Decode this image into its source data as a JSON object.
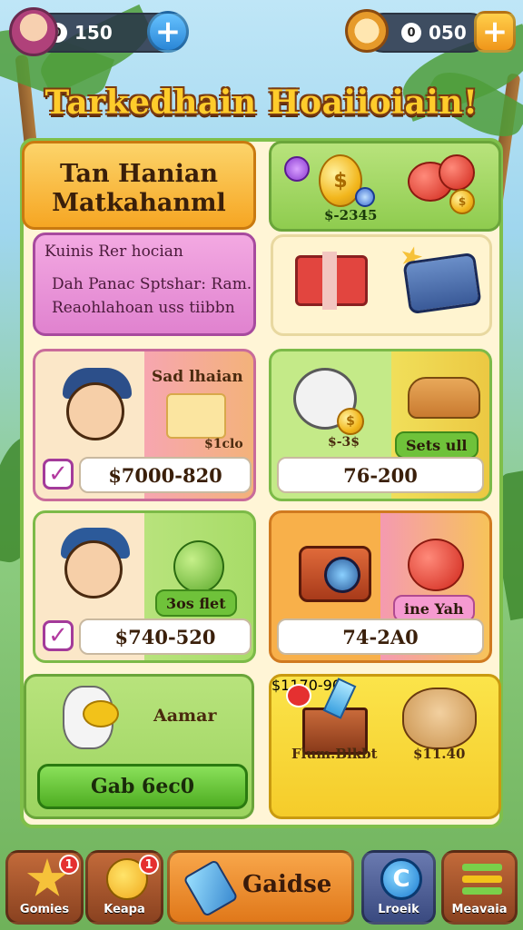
{
  "header": {
    "left_currency_value": "150",
    "left_currency_symbol": "0",
    "right_currency_value": "050",
    "right_currency_symbol": "0",
    "plus_symbol": "+"
  },
  "title": "Tarkedhain Hoaiioiain!",
  "banner": {
    "line1": "Tan Hanian",
    "line2": "Matkahanml"
  },
  "info_card": {
    "heading": "Kuinis Rer hocian",
    "line1": "Dah Panac Sptshar: Ram.",
    "line2": "Reaohlahoan uss tiibbn"
  },
  "top_right": {
    "price": "$-2345"
  },
  "items": [
    {
      "title": "Sad lhaian",
      "tag": "$1clo",
      "price": "$7000-820"
    },
    {
      "title": "Sets ull",
      "tag": "$-3$",
      "price": "76-200"
    },
    {
      "title": "3os flet",
      "price": "$740-520"
    },
    {
      "title": "ine Yah",
      "price": "74-2A0"
    }
  ],
  "bottom_left": {
    "title": "Aamar",
    "button": "Gab 6ec0"
  },
  "bottom_right": {
    "title": "Flum.Blkbt",
    "tag": "$11.40",
    "price": "$1170-90"
  },
  "nav": {
    "items": [
      {
        "label": "Gomies",
        "badge": "1"
      },
      {
        "label": "Keapa",
        "badge": "1"
      },
      {
        "label": "Gaidse"
      },
      {
        "label": "Lroeik"
      },
      {
        "label": "Meavaia"
      }
    ]
  },
  "colors": {
    "accent_orange": "#f6a623",
    "accent_green": "#6fc23a",
    "accent_pink": "#e082cf",
    "accent_blue": "#3a9ee8"
  }
}
